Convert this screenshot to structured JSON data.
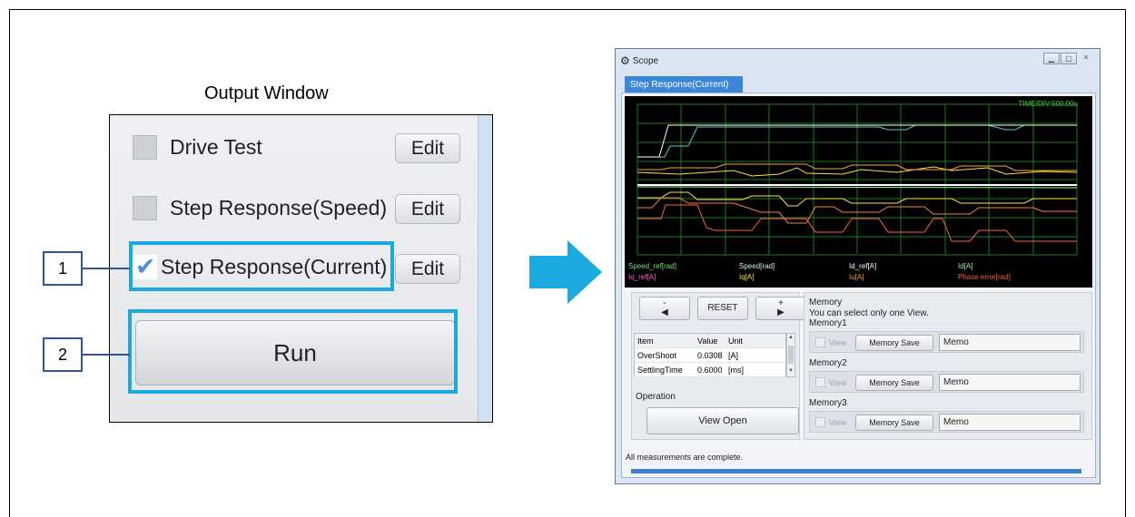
{
  "output_window": {
    "title": "Output Window",
    "items": [
      {
        "label": "Drive Test",
        "checked": false,
        "edit_label": "Edit"
      },
      {
        "label": "Step Response(Speed)",
        "checked": false,
        "edit_label": "Edit"
      },
      {
        "label": "Step Response(Current)",
        "checked": true,
        "edit_label": "Edit"
      }
    ],
    "run_label": "Run"
  },
  "callouts": [
    "1",
    "2"
  ],
  "scope": {
    "title": "Scope",
    "tab": "Step Response(Current)",
    "time_div": "TIME/DIV:500.00u",
    "legend": [
      {
        "label": "Speed_ref[rad]",
        "color": "#7fe07f"
      },
      {
        "label": "Speed[rad]",
        "color": "#d0f0f0"
      },
      {
        "label": "Id_ref[A]",
        "color": "#ffffff"
      },
      {
        "label": "Id[A]",
        "color": "#9cf09c"
      },
      {
        "label": "Iq_ref[A]",
        "color": "#ff66cc"
      },
      {
        "label": "Iq[A]",
        "color": "#ffe040"
      },
      {
        "label": "Iu[A]",
        "color": "#ffa040"
      },
      {
        "label": "Phase error[rad]",
        "color": "#ff6040"
      }
    ],
    "minus_label": "-",
    "plus_label": "+",
    "reset_label": "RESET",
    "table": {
      "headers": [
        "Item",
        "Value",
        "Unit"
      ],
      "rows": [
        [
          "OverShoot",
          "0.0308",
          "[A]"
        ],
        [
          "SettlingTime",
          "0.6000",
          "[ms]"
        ]
      ]
    },
    "operation_label": "Operation",
    "view_open_label": "View Open",
    "memory": {
      "title": "Memory",
      "note": "You can select only one View.",
      "slots": [
        {
          "name": "Memory1",
          "view_label": "View",
          "save_label": "Memory Save",
          "memo": "Memo"
        },
        {
          "name": "Memory2",
          "view_label": "View",
          "save_label": "Memory Save",
          "memo": "Memo"
        },
        {
          "name": "Memory3",
          "view_label": "View",
          "save_label": "Memory Save",
          "memo": "Memo"
        }
      ]
    },
    "status": "All measurements are complete.",
    "progress": 1.0
  }
}
